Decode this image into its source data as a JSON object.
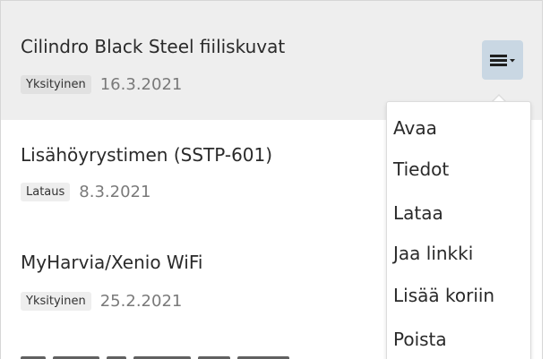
{
  "items": [
    {
      "title": "Cilindro Black Steel fiiliskuvat",
      "badge": "Yksityinen",
      "date": "16.3.2021",
      "selected": true
    },
    {
      "title": "Lisähöyrystimen (SSTP-601)",
      "badge": "Lataus",
      "date": "8.3.2021",
      "selected": false
    },
    {
      "title": "MyHarvia/Xenio WiFi",
      "badge": "Yksityinen",
      "date": "25.2.2021",
      "selected": false
    }
  ],
  "menu_button": {
    "icon": "hamburger-dropdown-icon"
  },
  "dropdown": {
    "items": [
      "Avaa",
      "Tiedot",
      "Lataa",
      "Jaa linkki",
      "Lisää koriin",
      "Poista"
    ]
  },
  "colors": {
    "selected_row": "#eeeeee",
    "menu_button": "#c9d7e3",
    "text": "#2a2a2a",
    "date": "#7a7a7a"
  }
}
